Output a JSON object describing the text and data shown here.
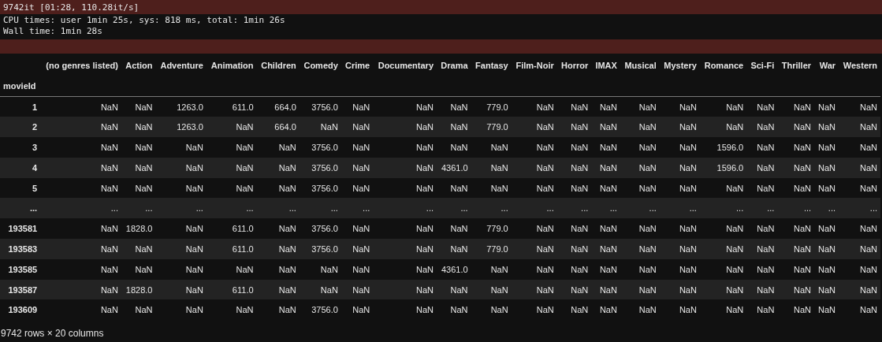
{
  "stderr_output": {
    "lines": [
      "9742it [01:28, 110.28it/s]"
    ]
  },
  "stdout_output": {
    "lines": [
      "CPU times: user 1min 25s, sys: 818 ms, total: 1min 26s",
      "Wall time: 1min 28s"
    ]
  },
  "table": {
    "columns": [
      "(no genres listed)",
      "Action",
      "Adventure",
      "Animation",
      "Children",
      "Comedy",
      "Crime",
      "Documentary",
      "Drama",
      "Fantasy",
      "Film-Noir",
      "Horror",
      "IMAX",
      "Musical",
      "Mystery",
      "Romance",
      "Sci-Fi",
      "Thriller",
      "War",
      "Western"
    ],
    "index_name": "movieId",
    "rows": [
      {
        "index": "1",
        "cells": [
          "NaN",
          "NaN",
          "1263.0",
          "611.0",
          "664.0",
          "3756.0",
          "NaN",
          "NaN",
          "NaN",
          "779.0",
          "NaN",
          "NaN",
          "NaN",
          "NaN",
          "NaN",
          "NaN",
          "NaN",
          "NaN",
          "NaN",
          "NaN"
        ]
      },
      {
        "index": "2",
        "cells": [
          "NaN",
          "NaN",
          "1263.0",
          "NaN",
          "664.0",
          "NaN",
          "NaN",
          "NaN",
          "NaN",
          "779.0",
          "NaN",
          "NaN",
          "NaN",
          "NaN",
          "NaN",
          "NaN",
          "NaN",
          "NaN",
          "NaN",
          "NaN"
        ]
      },
      {
        "index": "3",
        "cells": [
          "NaN",
          "NaN",
          "NaN",
          "NaN",
          "NaN",
          "3756.0",
          "NaN",
          "NaN",
          "NaN",
          "NaN",
          "NaN",
          "NaN",
          "NaN",
          "NaN",
          "NaN",
          "1596.0",
          "NaN",
          "NaN",
          "NaN",
          "NaN"
        ]
      },
      {
        "index": "4",
        "cells": [
          "NaN",
          "NaN",
          "NaN",
          "NaN",
          "NaN",
          "3756.0",
          "NaN",
          "NaN",
          "4361.0",
          "NaN",
          "NaN",
          "NaN",
          "NaN",
          "NaN",
          "NaN",
          "1596.0",
          "NaN",
          "NaN",
          "NaN",
          "NaN"
        ]
      },
      {
        "index": "5",
        "cells": [
          "NaN",
          "NaN",
          "NaN",
          "NaN",
          "NaN",
          "3756.0",
          "NaN",
          "NaN",
          "NaN",
          "NaN",
          "NaN",
          "NaN",
          "NaN",
          "NaN",
          "NaN",
          "NaN",
          "NaN",
          "NaN",
          "NaN",
          "NaN"
        ]
      },
      {
        "index": "...",
        "cells": [
          "...",
          "...",
          "...",
          "...",
          "...",
          "...",
          "...",
          "...",
          "...",
          "...",
          "...",
          "...",
          "...",
          "...",
          "...",
          "...",
          "...",
          "...",
          "...",
          "..."
        ]
      },
      {
        "index": "193581",
        "cells": [
          "NaN",
          "1828.0",
          "NaN",
          "611.0",
          "NaN",
          "3756.0",
          "NaN",
          "NaN",
          "NaN",
          "779.0",
          "NaN",
          "NaN",
          "NaN",
          "NaN",
          "NaN",
          "NaN",
          "NaN",
          "NaN",
          "NaN",
          "NaN"
        ]
      },
      {
        "index": "193583",
        "cells": [
          "NaN",
          "NaN",
          "NaN",
          "611.0",
          "NaN",
          "3756.0",
          "NaN",
          "NaN",
          "NaN",
          "779.0",
          "NaN",
          "NaN",
          "NaN",
          "NaN",
          "NaN",
          "NaN",
          "NaN",
          "NaN",
          "NaN",
          "NaN"
        ]
      },
      {
        "index": "193585",
        "cells": [
          "NaN",
          "NaN",
          "NaN",
          "NaN",
          "NaN",
          "NaN",
          "NaN",
          "NaN",
          "4361.0",
          "NaN",
          "NaN",
          "NaN",
          "NaN",
          "NaN",
          "NaN",
          "NaN",
          "NaN",
          "NaN",
          "NaN",
          "NaN"
        ]
      },
      {
        "index": "193587",
        "cells": [
          "NaN",
          "1828.0",
          "NaN",
          "611.0",
          "NaN",
          "NaN",
          "NaN",
          "NaN",
          "NaN",
          "NaN",
          "NaN",
          "NaN",
          "NaN",
          "NaN",
          "NaN",
          "NaN",
          "NaN",
          "NaN",
          "NaN",
          "NaN"
        ]
      },
      {
        "index": "193609",
        "cells": [
          "NaN",
          "NaN",
          "NaN",
          "NaN",
          "NaN",
          "3756.0",
          "NaN",
          "NaN",
          "NaN",
          "NaN",
          "NaN",
          "NaN",
          "NaN",
          "NaN",
          "NaN",
          "NaN",
          "NaN",
          "NaN",
          "NaN",
          "NaN"
        ]
      }
    ]
  },
  "shape_note": "9742 rows × 20 columns"
}
